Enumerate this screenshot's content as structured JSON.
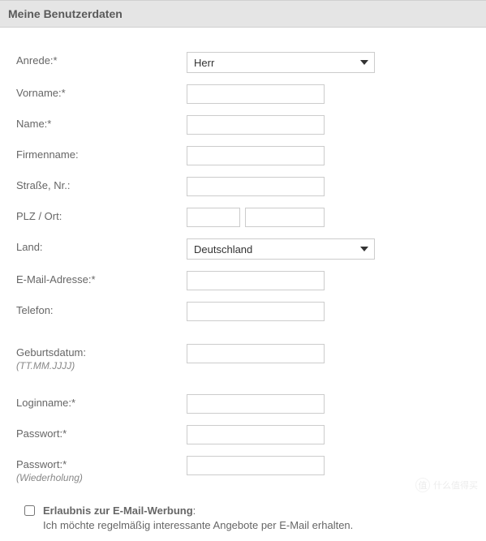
{
  "header": {
    "title": "Meine Benutzerdaten"
  },
  "form": {
    "anrede": {
      "label": "Anrede:*",
      "value": "Herr"
    },
    "vorname": {
      "label": "Vorname:*",
      "value": ""
    },
    "name": {
      "label": "Name:*",
      "value": ""
    },
    "firmenname": {
      "label": "Firmenname:",
      "value": ""
    },
    "strasse": {
      "label": "Straße, Nr.:",
      "value": ""
    },
    "plzort": {
      "label": "PLZ / Ort:",
      "plz": "",
      "ort": ""
    },
    "land": {
      "label": "Land:",
      "value": "Deutschland"
    },
    "email": {
      "label": "E-Mail-Adresse:*",
      "value": ""
    },
    "telefon": {
      "label": "Telefon:",
      "value": ""
    },
    "geburtsdatum": {
      "label": "Geburtsdatum:",
      "hint": "(TT.MM.JJJJ)",
      "value": ""
    },
    "loginname": {
      "label": "Loginname:*",
      "value": ""
    },
    "passwort": {
      "label": "Passwort:*",
      "value": ""
    },
    "passwort2": {
      "label": "Passwort:*",
      "hint": "(Wiederholung)",
      "value": ""
    }
  },
  "consent": {
    "title": "Erlaubnis zur E-Mail-Werbung",
    "colon": ":",
    "text": "Ich möchte regelmäßig interessante Angebote per E-Mail erhalten."
  },
  "watermark": {
    "char": "值",
    "text": "什么值得买"
  }
}
